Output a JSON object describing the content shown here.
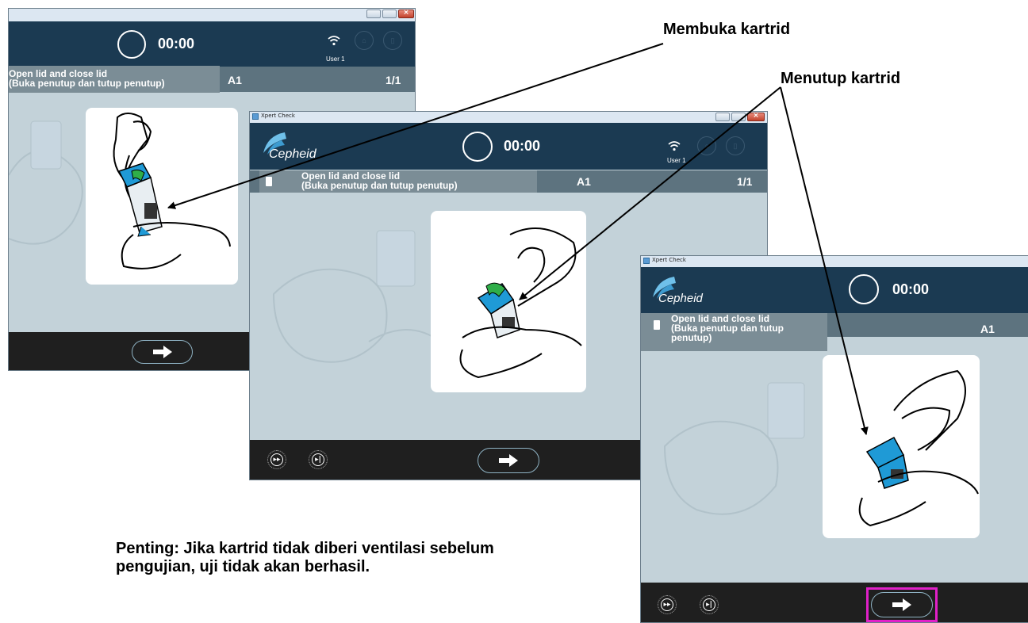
{
  "callouts": {
    "open": "Membuka kartrid",
    "close": "Menutup kartrid"
  },
  "note": {
    "line1": "Penting: Jika kartrid tidak diberi ventilasi sebelum",
    "line2": "pengujian, uji tidak akan berhasil."
  },
  "windows": [
    {
      "window_title": "",
      "timer": "00:00",
      "user": "User 1",
      "step_line1": "Open lid and close lid",
      "step_line2": "(Buka penutup dan tutup penutup)",
      "position": "A1",
      "count": "1/1"
    },
    {
      "window_title": "Xpert Check",
      "logo": "Cepheid",
      "timer": "00:00",
      "user": "User 1",
      "step_line1": "Open lid and close lid",
      "step_line2": "(Buka penutup dan tutup penutup)",
      "position": "A1",
      "count": "1/1"
    },
    {
      "window_title": "Xpert Check",
      "logo": "Cepheid",
      "timer": "00:00",
      "step_line1": "Open lid and close lid",
      "step_line2": "(Buka penutup dan tutup",
      "step_line3": "penutup)",
      "position": "A1"
    }
  ],
  "icons": {
    "next": "right-arrow-icon",
    "fast_forward": "fast-forward-icon",
    "skip": "skip-to-end-icon",
    "wifi": "wifi-icon",
    "home": "home-icon",
    "exit": "exit-icon",
    "cartridge": "cartridge-icon"
  },
  "colors": {
    "header": "#1b3a52",
    "background": "#c3d2d9",
    "step_bar": "#5d737f",
    "cartridge_blue": "#1f9ad6",
    "lid_green": "#2fae49",
    "highlight": "#e020c8"
  }
}
